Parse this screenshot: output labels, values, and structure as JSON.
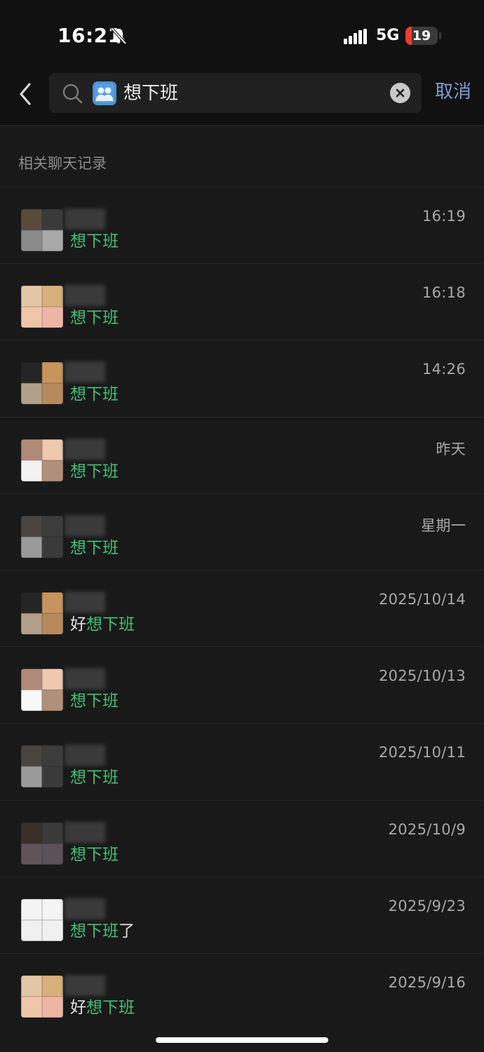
{
  "status_bar": {
    "time": "16:21",
    "network": "5G",
    "battery": "19",
    "battery_level": 0.19
  },
  "search": {
    "query": "想下班",
    "cancel_label": "取消"
  },
  "section_title": "相关聊天记录",
  "colors": {
    "highlight": "#3fc278",
    "cancel": "#7f9bd1",
    "background": "#191919"
  },
  "results": [
    {
      "date": "16:19",
      "prefix": "",
      "match": "想下班",
      "suffix": "",
      "avatar": [
        "#5a4a3c",
        "#3a3a3a",
        "#8a8a8a",
        "#a8a8a8"
      ]
    },
    {
      "date": "16:18",
      "prefix": "",
      "match": "想下班",
      "suffix": "",
      "avatar": [
        "#e2c6a8",
        "#d8b07a",
        "#efc6aa",
        "#eeb5a4"
      ]
    },
    {
      "date": "14:26",
      "prefix": "",
      "match": "想下班",
      "suffix": "",
      "avatar": [
        "#252525",
        "#c8945e",
        "#b2a08a",
        "#b78a5e"
      ]
    },
    {
      "date": "昨天",
      "prefix": "",
      "match": "想下班",
      "suffix": "",
      "avatar": [
        "#b08a78",
        "#f0c8b0",
        "#f2f2f2",
        "#b09078"
      ]
    },
    {
      "date": "星期一",
      "prefix": "",
      "match": "想下班",
      "suffix": "",
      "avatar": [
        "#4a4440",
        "#3c3c3c",
        "#9a9a9a",
        "#3a3a3a"
      ]
    },
    {
      "date": "2025/10/14",
      "prefix": "好",
      "match": "想下班",
      "suffix": "",
      "avatar": [
        "#252525",
        "#c8945e",
        "#b2a08a",
        "#b78a5e"
      ]
    },
    {
      "date": "2025/10/13",
      "prefix": "",
      "match": "想下班",
      "suffix": "",
      "avatar": [
        "#b08a78",
        "#f0c8b0",
        "#f8f8f8",
        "#b09078"
      ]
    },
    {
      "date": "2025/10/11",
      "prefix": "",
      "match": "想下班",
      "suffix": "",
      "avatar": [
        "#4a4440",
        "#3c3c3c",
        "#9a9a9a",
        "#3a3a3a"
      ]
    },
    {
      "date": "2025/10/9",
      "prefix": "",
      "match": "想下班",
      "suffix": "",
      "avatar": [
        "#3a3028",
        "#3a3a3a",
        "#605458",
        "#5a5258"
      ]
    },
    {
      "date": "2025/9/23",
      "prefix": "",
      "match": "想下班",
      "suffix": "了",
      "avatar": [
        "#f4f4f4",
        "#f4f4f4",
        "#f0f0f0",
        "#f0f0f0"
      ]
    },
    {
      "date": "2025/9/16",
      "prefix": "好",
      "match": "想下班",
      "suffix": "",
      "avatar": [
        "#e2c6a8",
        "#d8b07a",
        "#efc6aa",
        "#eeb5a4"
      ]
    }
  ]
}
